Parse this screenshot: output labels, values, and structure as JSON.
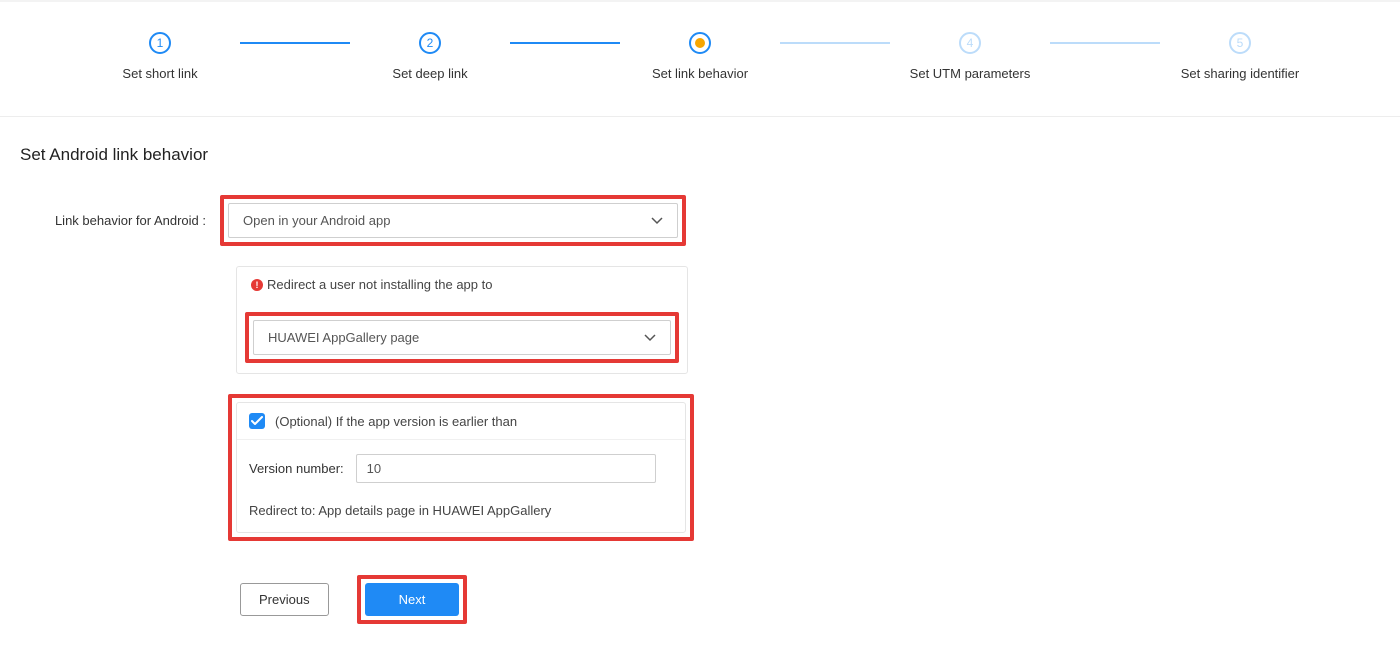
{
  "stepper": {
    "steps": [
      {
        "num": "1",
        "label": "Set short link",
        "state": "done"
      },
      {
        "num": "2",
        "label": "Set deep link",
        "state": "done"
      },
      {
        "num": "",
        "label": "Set link behavior",
        "state": "active"
      },
      {
        "num": "4",
        "label": "Set UTM parameters",
        "state": "future"
      },
      {
        "num": "5",
        "label": "Set sharing identifier",
        "state": "future"
      }
    ]
  },
  "section_title": "Set Android link behavior",
  "behavior_label": "Link behavior for Android :",
  "behavior_select": "Open in your Android app",
  "redirect_panel": {
    "heading": "Redirect a user not installing the app to",
    "select": "HUAWEI AppGallery page"
  },
  "version_panel": {
    "checkbox_label": "(Optional) If the app version is earlier than",
    "version_label": "Version number:",
    "version_value": "10",
    "redirect_line": "Redirect to: App details page in HUAWEI AppGallery"
  },
  "buttons": {
    "previous": "Previous",
    "next": "Next"
  }
}
